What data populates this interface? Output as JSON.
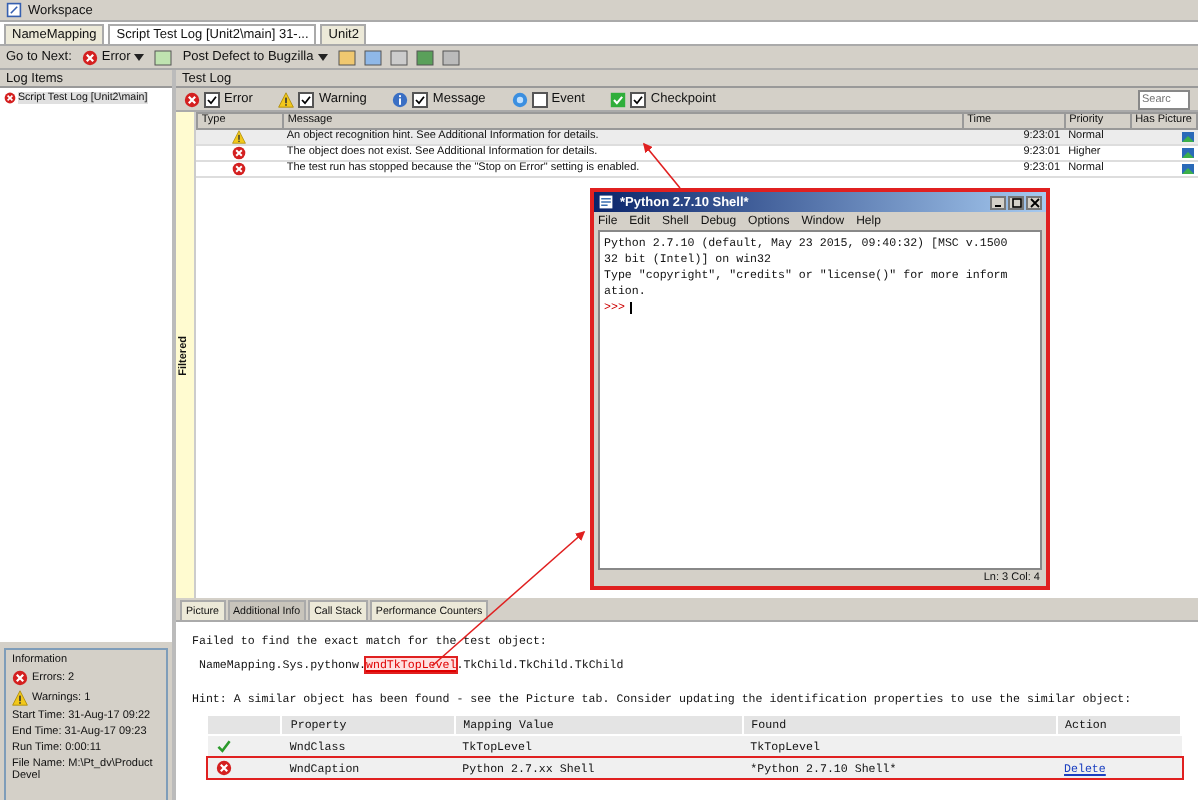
{
  "window": {
    "title": "Workspace"
  },
  "tabs": [
    {
      "label": "NameMapping",
      "selected": false
    },
    {
      "label": "Script Test Log [Unit2\\main] 31-...",
      "selected": true
    },
    {
      "label": "Unit2",
      "selected": false
    }
  ],
  "toolbar": {
    "go_to_next": "Go to Next:",
    "error_button": "Error",
    "post_defect": "Post Defect to Bugzilla"
  },
  "log_items": {
    "header": "Log Items",
    "items": [
      {
        "label": "Script Test Log [Unit2\\main]",
        "selected": true
      }
    ]
  },
  "information": {
    "title": "Information",
    "errors": "Errors: 2",
    "warnings": "Warnings: 1",
    "start_time": "Start Time: 31-Aug-17 09:22",
    "end_time": "End Time: 31-Aug-17 09:23",
    "run_time": "Run Time: 0:00:11",
    "file_name": "File Name: M:\\Pt_dv\\Product Devel"
  },
  "test_log": {
    "header": "Test Log",
    "filters": [
      {
        "kind": "error",
        "label": "Error",
        "checked": true
      },
      {
        "kind": "warning",
        "label": "Warning",
        "checked": true
      },
      {
        "kind": "message",
        "label": "Message",
        "checked": true
      },
      {
        "kind": "event",
        "label": "Event",
        "checked": false
      },
      {
        "kind": "checkpoint",
        "label": "Checkpoint",
        "checked": true
      }
    ],
    "search": {
      "placeholder": "Searc"
    },
    "filtered_label": "Filtered",
    "columns": [
      "Type",
      "Message",
      "Time",
      "Priority",
      "Has Picture"
    ],
    "rows": [
      {
        "kind": "warning",
        "message": "An object recognition hint. See Additional Information for details.",
        "time": "9:23:01",
        "priority": "Normal",
        "has_picture": true,
        "selected": true
      },
      {
        "kind": "error",
        "message": "The object does not exist. See Additional Information for details.",
        "time": "9:23:01",
        "priority": "Higher",
        "has_picture": true,
        "selected": false
      },
      {
        "kind": "error",
        "message": "The test run has stopped because the \"Stop on Error\" setting is enabled.",
        "time": "9:23:01",
        "priority": "Normal",
        "has_picture": true,
        "selected": false
      }
    ]
  },
  "shell": {
    "title": "*Python 2.7.10 Shell*",
    "menu": [
      "File",
      "Edit",
      "Shell",
      "Debug",
      "Options",
      "Window",
      "Help"
    ],
    "lines": [
      "Python 2.7.10 (default, May 23 2015, 09:40:32) [MSC v.1500",
      "32 bit (Intel)] on win32",
      "Type \"copyright\", \"credits\" or \"license()\" for more inform",
      "ation."
    ],
    "prompt": ">>>",
    "status": "Ln: 3 Col: 4"
  },
  "detail_tabs": [
    {
      "label": "Picture",
      "selected": false
    },
    {
      "label": "Additional Info",
      "selected": true
    },
    {
      "label": "Call Stack",
      "selected": false
    },
    {
      "label": "Performance Counters",
      "selected": false
    }
  ],
  "details": {
    "failed_text": "Failed to find the exact match for the test object:",
    "path_prefix": "NameMapping.Sys.pythonw.",
    "path_highlight": "wndTkTopLevel",
    "path_suffix": ".TkChild.TkChild.TkChild",
    "hint": "Hint: A similar object has been found - see the Picture tab. Consider updating the identification properties to use the similar object:",
    "columns": [
      "Property",
      "Mapping Value",
      "Found",
      "Action"
    ],
    "rows": [
      {
        "kind": "ok",
        "property": "WndClass",
        "mapping_value": "TkTopLevel",
        "found": "TkTopLevel",
        "highlighted": false
      },
      {
        "kind": "error",
        "property": "WndCaption",
        "mapping_value": "Python 2.7.xx Shell",
        "found": "*Python 2.7.10 Shell*",
        "action": "Delete",
        "highlighted": true
      }
    ]
  }
}
